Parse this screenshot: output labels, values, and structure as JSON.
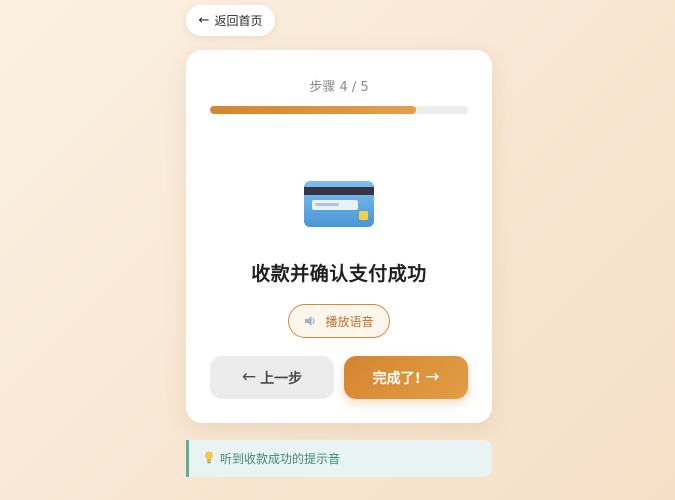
{
  "back_button": {
    "arrow": "←",
    "label": "返回首页"
  },
  "step": {
    "label": "步骤 4 / 5",
    "current": 4,
    "total": 5,
    "progress_fraction": 0.8
  },
  "illustration": {
    "icon": "credit-card-icon"
  },
  "task": {
    "title": "收款并确认支付成功"
  },
  "audio": {
    "icon": "speaker-icon",
    "label": "播放语音"
  },
  "navigation": {
    "prev": {
      "arrow": "←",
      "label": "上一步"
    },
    "next": {
      "label": "完成了!",
      "arrow": "→"
    }
  },
  "hint": {
    "icon": "lightbulb-icon",
    "text": "听到收款成功的提示音"
  },
  "colors": {
    "accent": "#d4862f",
    "hint_border": "#5fb09a",
    "hint_text": "#3f8a73"
  }
}
